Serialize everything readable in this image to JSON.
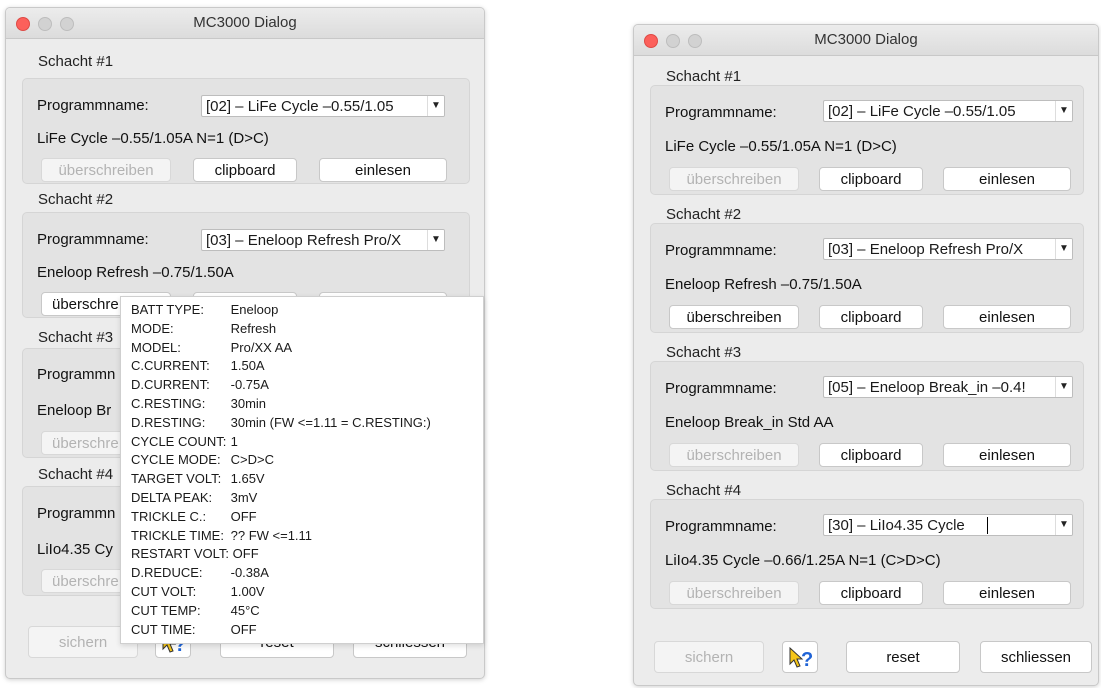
{
  "window": {
    "title": "MC3000 Dialog"
  },
  "common": {
    "program_label": "Programmname:",
    "overwrite_label": "überschreiben",
    "clipboard_label": "clipboard",
    "read_label": "einlesen",
    "save_label": "sichern",
    "reset_label": "reset",
    "close_label": "schliessen",
    "dropdown_arrow": "▼"
  },
  "left": {
    "slots": [
      {
        "label": "Schacht #1",
        "program": "[02] – LiFe Cycle –0.55/1.05",
        "info": "LiFe  Cycle  –0.55/1.05A  N=1 (D>C)"
      },
      {
        "label": "Schacht #2",
        "program": "[03] – Eneloop Refresh Pro/X",
        "info": "Eneloop  Refresh  –0.75/1.50A"
      },
      {
        "label": "Schacht #3",
        "program_partial": "Programmn",
        "info_partial": "Eneloop  Br"
      },
      {
        "label": "Schacht #4",
        "program_partial": "Programmn",
        "info_partial": "LiIo4.35  Cy"
      }
    ],
    "slot2_overwrite_partial": "überschre",
    "overwrite_partial": "überschre",
    "reset_partial": "reset",
    "close_partial": "schliessen"
  },
  "tooltip": {
    "rows": [
      {
        "k": "BATT TYPE:",
        "v": "Eneloop"
      },
      {
        "k": "MODE:",
        "v": "Refresh"
      },
      {
        "k": "MODEL:",
        "v": "Pro/XX AA"
      },
      {
        "k": "C.CURRENT:",
        "v": "1.50A"
      },
      {
        "k": "D.CURRENT:",
        "v": "-0.75A"
      },
      {
        "k": "C.RESTING:",
        "v": "30min"
      },
      {
        "k": "D.RESTING:",
        "v": "30min (FW <=1.11 = C.RESTING:)"
      },
      {
        "k": "CYCLE COUNT:",
        "v": "1"
      },
      {
        "k": "CYCLE MODE:",
        "v": "C>D>C"
      },
      {
        "k": "TARGET VOLT:",
        "v": "1.65V"
      },
      {
        "k": "DELTA PEAK:",
        "v": "3mV"
      },
      {
        "k": "TRICKLE C.:",
        "v": "OFF"
      },
      {
        "k": "TRICKLE TIME:",
        "v": "?? FW <=1.11"
      },
      {
        "k": "RESTART VOLT:",
        "v": "OFF"
      },
      {
        "k": "D.REDUCE:",
        "v": "-0.38A"
      },
      {
        "k": "CUT VOLT:",
        "v": "1.00V"
      },
      {
        "k": "CUT TEMP:",
        "v": "45°C"
      },
      {
        "k": "CUT TIME:",
        "v": "OFF"
      }
    ]
  },
  "right": {
    "slots": [
      {
        "label": "Schacht #1",
        "program": "[02] – LiFe Cycle –0.55/1.05",
        "info": "LiFe  Cycle  –0.55/1.05A  N=1 (D>C)"
      },
      {
        "label": "Schacht #2",
        "program": "[03] – Eneloop Refresh Pro/X",
        "info": "Eneloop  Refresh  –0.75/1.50A"
      },
      {
        "label": "Schacht #3",
        "program": "[05] – Eneloop Break_in –0.4!",
        "info": "Eneloop  Break_in  Std AA"
      },
      {
        "label": "Schacht #4",
        "program": "[30] – LiIo4.35 Cycle",
        "info": "LiIo4.35  Cycle  –0.66/1.25A  N=1 (C>D>C)"
      }
    ]
  },
  "colors": {
    "close": "#fc605b",
    "inactive_light": "#d2d2d2",
    "help_arrow": "#f5c518",
    "help_question": "#1f63d6"
  }
}
